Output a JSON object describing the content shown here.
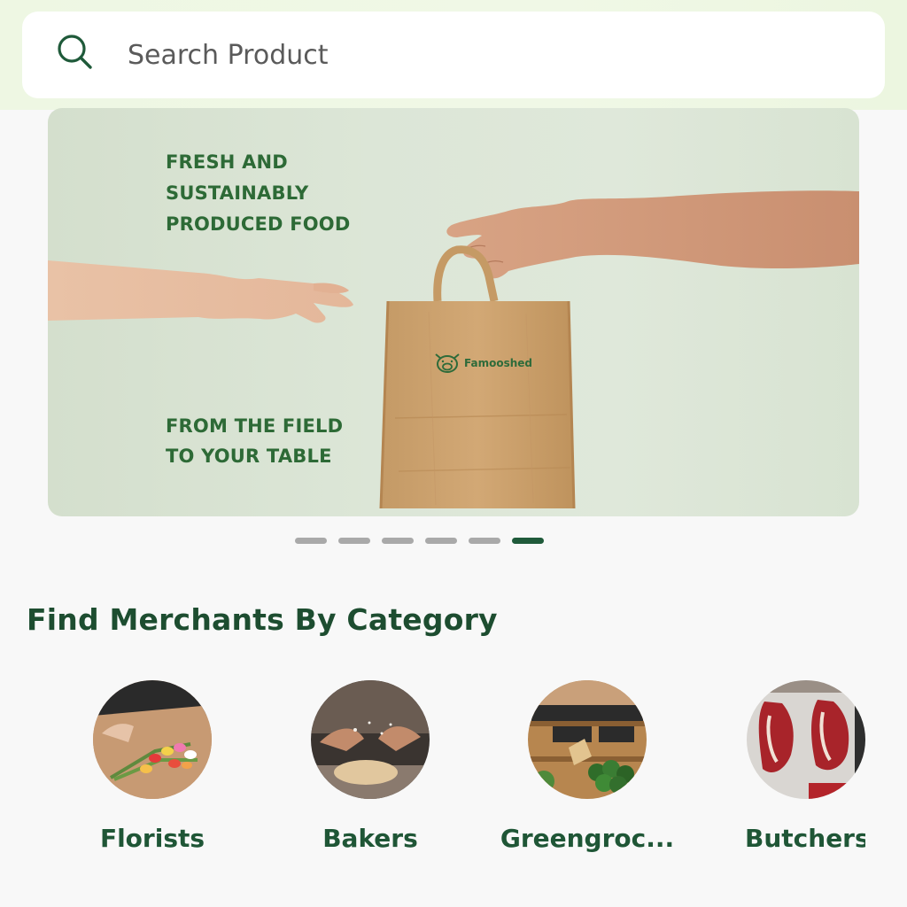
{
  "search": {
    "placeholder": "Search Product",
    "value": ""
  },
  "banner": {
    "headline": [
      "FRESH AND",
      "SUSTAINABLY",
      "PRODUCED FOOD"
    ],
    "tagline": [
      "FROM THE FIELD",
      "TO YOUR TABLE"
    ],
    "brand": "Famooshed",
    "active_slide": 6,
    "slide_count": 6
  },
  "section": {
    "title": "Find Merchants By Category"
  },
  "categories": [
    {
      "label": "Florists",
      "icon": "florists-image"
    },
    {
      "label": "Bakers",
      "icon": "bakers-image"
    },
    {
      "label": "Greengroc...",
      "icon": "greengrocers-image"
    },
    {
      "label": "Butchers",
      "icon": "butchers-image"
    }
  ],
  "colors": {
    "brand_green": "#1f5a3a",
    "banner_text": "#2d6a36",
    "dot_inactive": "#a9a9a9",
    "background": "#f8f8f8"
  }
}
